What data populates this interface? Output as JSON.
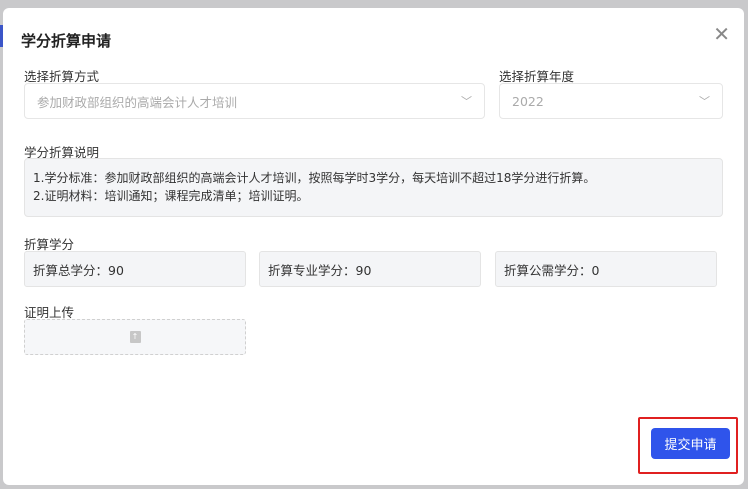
{
  "dialog": {
    "title": "学分折算申请",
    "close_icon": "close-icon"
  },
  "method": {
    "label": "选择折算方式",
    "value": "参加财政部组织的高端会计人才培训"
  },
  "year": {
    "label": "选择折算年度",
    "value": "2022"
  },
  "description": {
    "label": "学分折算说明",
    "lines": [
      "1.学分标准：参加财政部组织的高端会计人才培训，按照每学时3学分，每天培训不超过18学分进行折算。",
      "2.证明材料：培训通知；课程完成清单；培训证明。"
    ]
  },
  "credits": {
    "label": "折算学分",
    "total": "折算总学分：90",
    "professional": "折算专业学分：90",
    "public": "折算公需学分：0"
  },
  "upload": {
    "label": "证明上传"
  },
  "submit_label": "提交申请",
  "colors": {
    "primary": "#2f54eb",
    "highlight": "#e02020"
  }
}
